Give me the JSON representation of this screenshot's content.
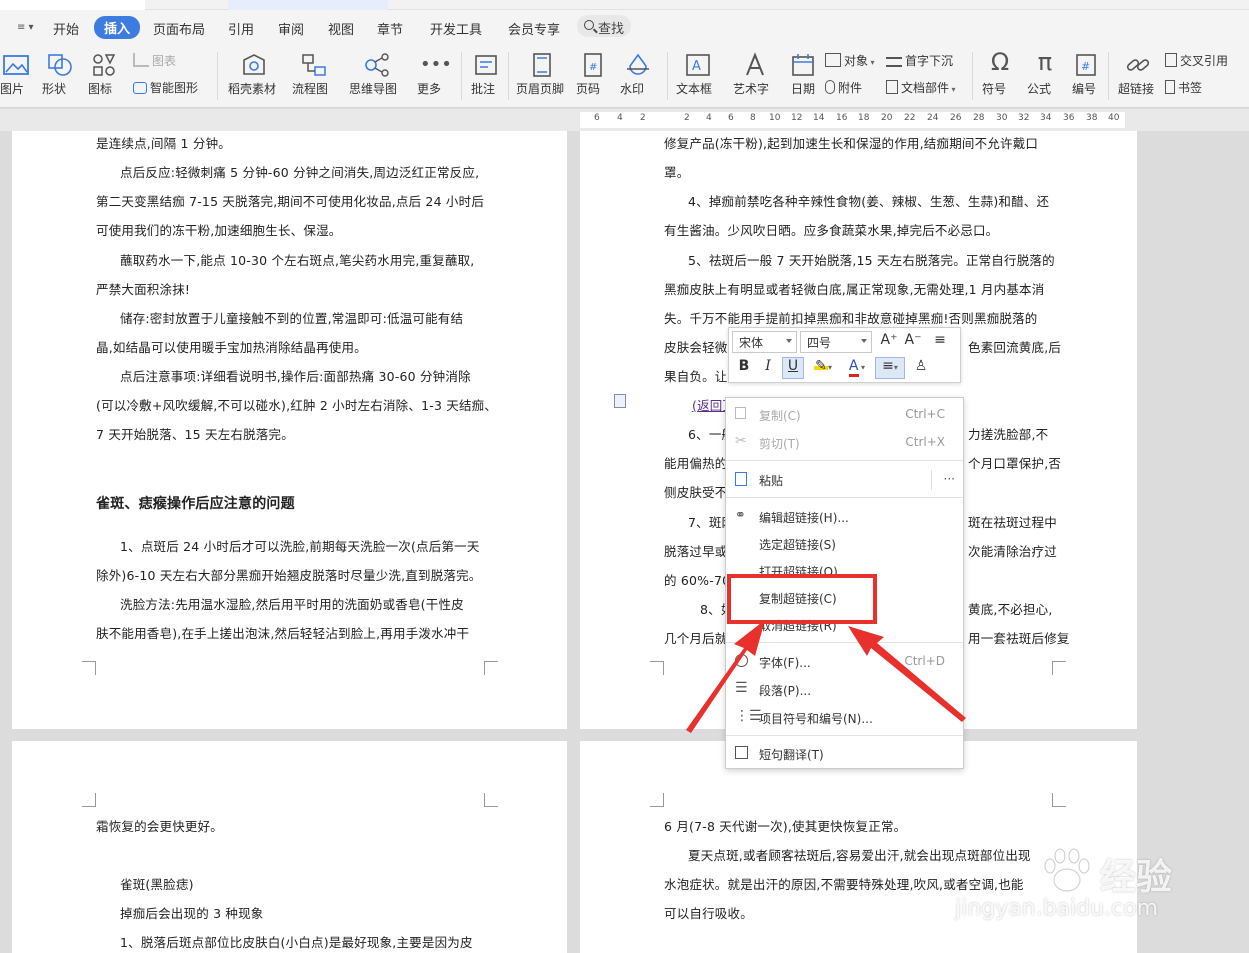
{
  "menubar": {
    "collapse_glyph": "≡ ▾",
    "items": [
      "开始",
      "插入",
      "页面布局",
      "引用",
      "审阅",
      "视图",
      "章节",
      "开发工具",
      "会员专享"
    ],
    "active_index": 1,
    "search_label": "查找"
  },
  "ribbon": {
    "picture": "图片",
    "shape": "形状",
    "icon": "图标",
    "chart": "图表",
    "smart_shape": "智能图形",
    "stock_material": "稻壳素材",
    "flowchart": "流程图",
    "mindmap": "思维导图",
    "more": "更多",
    "comment": "批注",
    "header_footer": "页眉页脚",
    "page_number": "页码",
    "watermark": "水印",
    "textbox": "文本框",
    "wordart": "艺术字",
    "date": "日期",
    "object": "对象",
    "attachment": "附件",
    "dropcap": "首字下沉",
    "doc_parts": "文档部件",
    "symbol": "符号",
    "formula": "公式",
    "numbering": "编号",
    "hyperlink": "超链接",
    "cross_ref": "交叉引用",
    "bookmark": "书签"
  },
  "ruler": {
    "ticks": [
      "6",
      "4",
      "2",
      "2",
      "4",
      "6",
      "8",
      "10",
      "12",
      "14",
      "16",
      "18",
      "20",
      "22",
      "24",
      "26",
      "28",
      "30",
      "32",
      "34",
      "36",
      "38",
      "40"
    ]
  },
  "page_left_top": {
    "lines": [
      "是连续点,间隔 1 分钟。",
      "点后反应:轻微刺痛 5 分钟-60 分钟之间消失,周边泛红正常反应,",
      "第二天变黑结痂 7-15 天脱落完,期间不可使用化妆品,点后 24 小时后",
      "可使用我们的冻干粉,加速细胞生长、保湿。",
      "蘸取药水一下,能点 10-30 个左右斑点,笔尖药水用完,重复蘸取,",
      "严禁大面积涂抹!",
      "储存:密封放置于儿童接触不到的位置,常温即可:低温可能有结",
      "晶,如结晶可以使用暖手宝加热消除结晶再使用。",
      "点后注意事项:详细看说明书,操作后:面部热痛 30-60 分钟消除",
      "(可以冷敷+风吹缓解,不可以碰水),红肿 2 小时左右消除、1-3 天结痂、",
      "7 天开始脱落、15 天左右脱落完。"
    ],
    "heading": "雀斑、痣瘊操作后应注意的问题",
    "lines2": [
      "1、点斑后 24 小时后才可以洗脸,前期每天洗脸一次(点后第一天",
      "除外)6-10 天左右大部分黑痂开始翘皮脱落时尽量少洗,直到脱落完。",
      "洗脸方法:先用温水湿脸,然后用平时用的洗面奶或香皂(干性皮",
      "肤不能用香皂),在手上搓出泡沫,然后轻轻沾到脸上,再用手泼水冲干"
    ]
  },
  "page_right_top": {
    "lines": [
      "修复产品(冻干粉),起到加速生长和保湿的作用,结痂期间不允许戴口",
      "罩。",
      "4、掉痂前禁吃各种辛辣性食物(姜、辣椒、生葱、生蒜)和醋、还",
      "有生酱油。少风吹日晒。应多食蔬菜水果,掉完后不必忌口。",
      "5、祛斑后一般 7 天开始脱落,15 天左右脱落完。正常自行脱落的",
      "黑痂皮肤上有明显或者轻微白底,属正常现象,无需处理,1 月内基本消",
      "失。千万不能用手提前扣掉黑痂和非故意碰掉黑痂!否则黑痂脱落的",
      "皮肤会轻微",
      "果自负。让",
      "(返回顶部)",
      "6、一般",
      "能用偏热的",
      "侧皮肤受不",
      "7、斑网",
      "脱落过早或",
      "的 60%-70%",
      "8、如",
      "几个月后就"
    ],
    "right_fragments": [
      "色素回流黄底,后",
      "力搓洗脸部,不",
      "个月口罩保护,否",
      "斑在祛斑过程中",
      "次能清除治疗过",
      "黄底,不必担心,",
      "用一套祛斑后修复"
    ]
  },
  "page_left_bottom": {
    "lines": [
      "霜恢复的会更快更好。",
      "雀斑(黑脸痣)",
      "掉痂后会出现的 3 种现象",
      "1、脱落后斑点部位比皮肤白(小白点)是最好现象,主要是因为皮"
    ]
  },
  "page_right_bottom": {
    "lines": [
      "6 月(7-8 天代谢一次),使其更快恢复正常。",
      "夏天点斑,或者顾客祛斑后,容易爱出汗,就会出现点斑部位出现",
      "水泡症状。就是出汗的原因,不需要特殊处理,吹风,或者空调,也能",
      "可以自行吸收。"
    ]
  },
  "mini_toolbar": {
    "font": "宋体",
    "size": "四号",
    "grow": "A⁺",
    "shrink": "A⁻",
    "bold": "B",
    "italic": "I",
    "underline": "U",
    "font_color": "A"
  },
  "context_menu": {
    "copy": "复制(C)",
    "copy_sc": "Ctrl+C",
    "cut": "剪切(T)",
    "cut_sc": "Ctrl+X",
    "paste": "粘贴",
    "paste_more": "···",
    "edit_link": "编辑超链接(H)...",
    "select_link": "选定超链接(S)",
    "open_link": "打开超链接(O)",
    "copy_link": "复制超链接(C)",
    "cancel_link": "取消超链接(R)",
    "font": "字体(F)...",
    "font_sc": "Ctrl+D",
    "paragraph": "段落(P)...",
    "bullets": "项目符号和编号(N)...",
    "translate": "短句翻译(T)"
  },
  "watermark": {
    "brand": "经验",
    "url": "jingyan.baidu.com"
  },
  "colors": {
    "accent": "#3c7be0",
    "highlight_red": "#e8312c",
    "link_purple": "#5a2f8c"
  }
}
